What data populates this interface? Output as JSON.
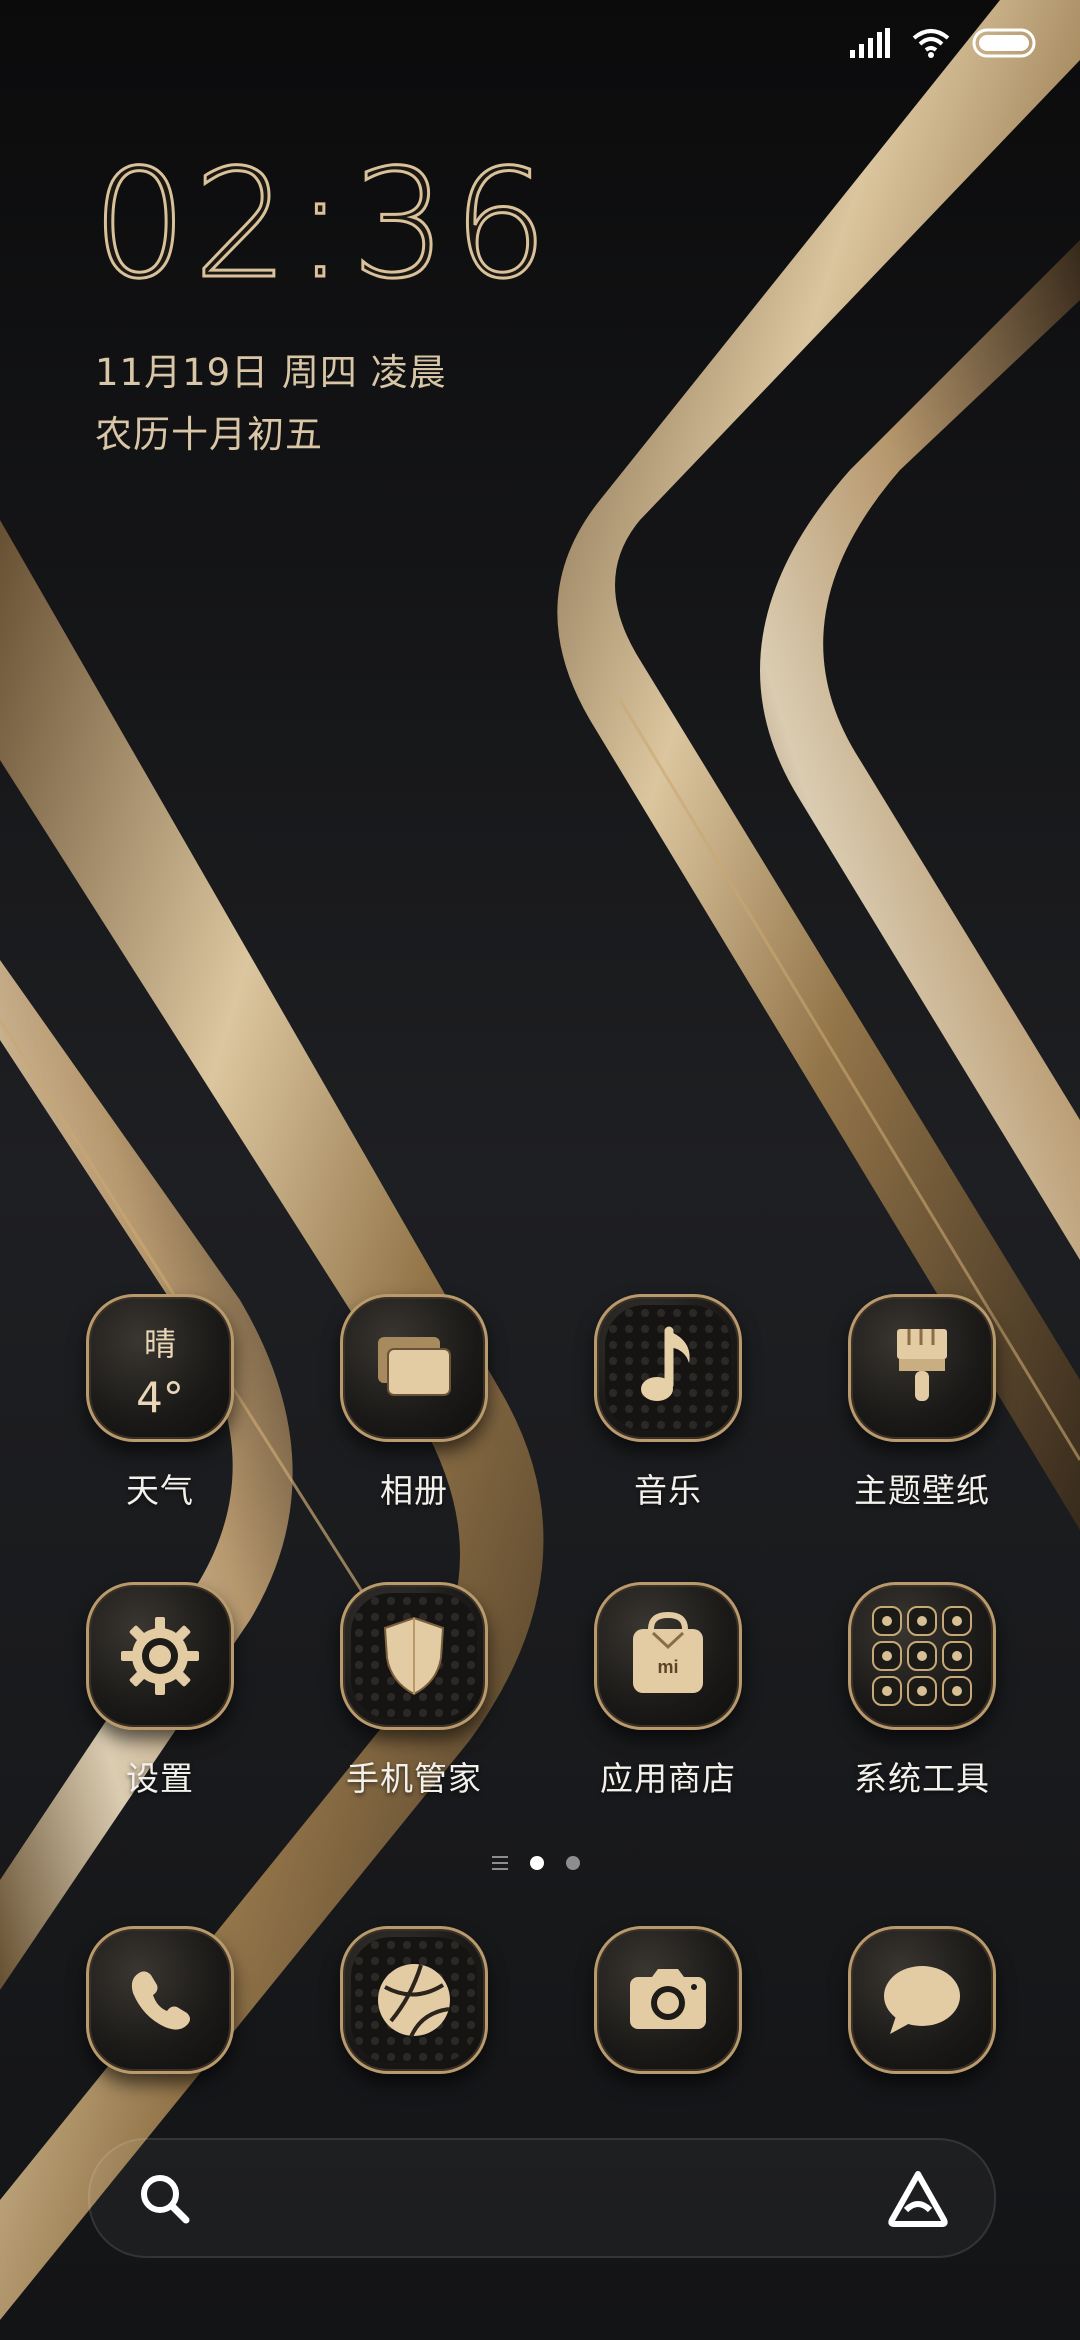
{
  "status_bar": {
    "signal_icon": "cellular-signal-icon",
    "wifi_icon": "wifi-icon",
    "battery_icon": "battery-icon"
  },
  "lock_widget": {
    "time": "02:36",
    "date": "11月19日  周四  凌晨",
    "lunar_date": "农历十月初五"
  },
  "apps_row1": [
    {
      "label": "天气",
      "icon": "weather-icon",
      "condition": "晴",
      "temperature": "4°"
    },
    {
      "label": "相册",
      "icon": "gallery-icon"
    },
    {
      "label": "音乐",
      "icon": "music-note-icon"
    },
    {
      "label": "主题壁纸",
      "icon": "paintbrush-icon"
    }
  ],
  "apps_row2": [
    {
      "label": "设置",
      "icon": "gear-icon"
    },
    {
      "label": "手机管家",
      "icon": "shield-icon"
    },
    {
      "label": "应用商店",
      "icon": "store-bag-icon",
      "badge_text": "mi"
    },
    {
      "label": "系统工具",
      "icon": "folder-grid-icon"
    }
  ],
  "page_indicator": {
    "pages": 2,
    "active_page": 1
  },
  "dock": [
    {
      "icon": "phone-icon"
    },
    {
      "icon": "browser-globe-icon"
    },
    {
      "icon": "camera-icon"
    },
    {
      "icon": "message-bubble-icon"
    }
  ],
  "search_bar": {
    "search_icon": "search-icon",
    "assistant_icon": "assistant-a-icon"
  },
  "colors": {
    "accent_gold": "#d9c19a",
    "background": "#121315",
    "dot_active": "#ffffff",
    "dot_inactive": "#8d8d8d"
  }
}
